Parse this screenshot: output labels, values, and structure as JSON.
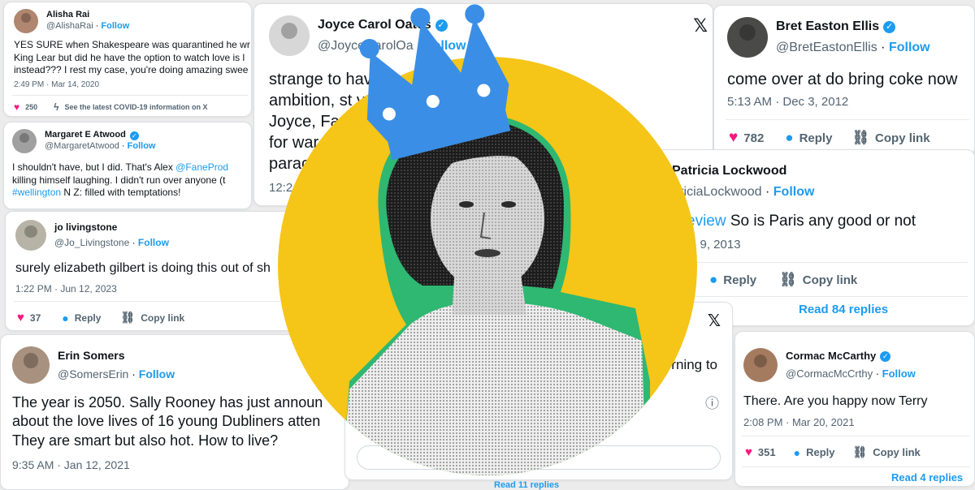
{
  "common": {
    "follow": "Follow",
    "reply": "Reply",
    "copy_link": "Copy link",
    "dot": "·"
  },
  "tweets": {
    "alisha": {
      "name": "Alisha Rai",
      "handle": "@AlishaRai",
      "text": "YES SURE when Shakespeare was quarantined he wr\nKing Lear but did he have the option to watch love is l\ninstead??? I rest my case, you're doing amazing swee",
      "time": "2:49 PM · Mar 14, 2020",
      "likes": "250",
      "covid": "See the latest COVID-19 information on X"
    },
    "atwood": {
      "name": "Margaret E Atwood",
      "handle": "@MargaretAtwood",
      "text_pre": "I shouldn't have, but I did. That's Alex ",
      "mention": "@FaneProd",
      "text_mid": "\nkilling himself laughing. I didn't run over anyone (t\n",
      "hashtag": "#wellington",
      "text_post": " N Z: filled with temptations!"
    },
    "jo": {
      "name": "jo livingstone",
      "handle": "@Jo_Livingstone",
      "text": "surely elizabeth gilbert is doing this out of sh",
      "time": "1:22 PM · Jun 12, 2023",
      "likes": "37"
    },
    "somers": {
      "name": "Erin Somers",
      "handle": "@SomersErin",
      "text": "The year is 2050. Sally Rooney has just announ\nabout the love lives of 16 young Dubliners atten\nThey are smart but also hot. How to live?",
      "time": "9:35 AM · Jan 12, 2021"
    },
    "oates": {
      "name": "Joyce Carol Oates",
      "handle": "@JoyceCarolOa",
      "text": "strange to have                                          at novels of\nambition, st                                            vsky, Woolf,\nJoyce, Fa                                                 cclaimed\nfor war                                                     ween\nparac",
      "time": "12:2"
    },
    "ellis": {
      "name": "Bret Easton Ellis",
      "handle": "@BretEastonEllis",
      "text": "come over at do bring coke now",
      "time": "5:13 AM · Dec 3, 2012",
      "likes": "782"
    },
    "lockwood": {
      "name": "Patricia Lockwood",
      "handle": "TriciaLockwood",
      "mention": "eview",
      "text": " So is Paris any good or not",
      "time": "n 9, 2013",
      "read_replies": "Read 84 replies"
    },
    "partial": {
      "text": "rning to",
      "read_replies": "Read 11 replies"
    },
    "mccarthy": {
      "name": "Cormac McCarthy",
      "handle": "@CormacMcCrthy",
      "text": "There. Are you happy now Terry",
      "time": "2:08 PM · Mar 20, 2021",
      "likes": "351",
      "read_replies": "Read 4 replies"
    }
  },
  "icons": {
    "x_logo": "𝕏",
    "heart": "♥",
    "bubble": "💬",
    "link": "🔗",
    "info": "ⓘ",
    "bolt": "ϟ"
  },
  "colors": {
    "accent": "#1d9bf0",
    "like": "#f91880",
    "circle": "#f5c518",
    "crown": "#3a8ee6",
    "outline": "#2eb872"
  }
}
